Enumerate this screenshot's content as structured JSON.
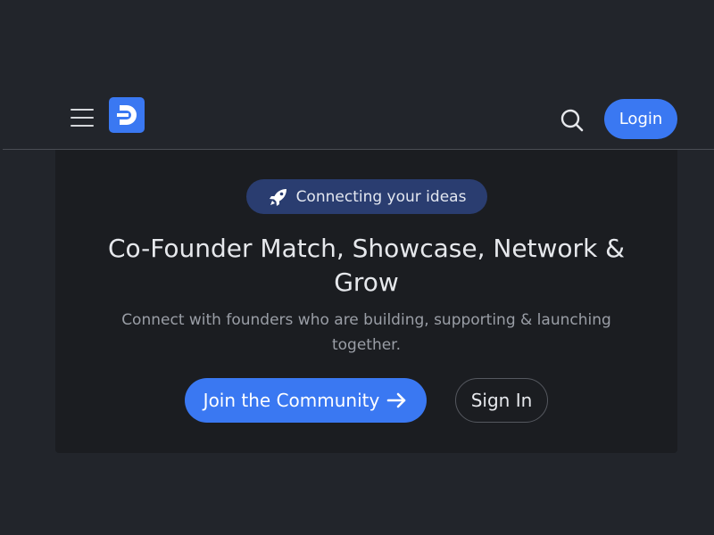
{
  "header": {
    "login_label": "Login",
    "icons": [
      "menu-icon",
      "logo-icon",
      "search-icon"
    ]
  },
  "hero": {
    "badge_text": "Connecting your ideas",
    "badge_icon": "rocket-icon",
    "title": "Co-Founder Match, Showcase, Network & Grow",
    "subtitle": "Connect with founders who are building, supporting & launching together.",
    "join_label": "Join the Community",
    "join_icon": "arrow-right-icon",
    "signin_label": "Sign In"
  },
  "colors": {
    "background": "#22252b",
    "card": "#1b1d21",
    "accent": "#3a78f2",
    "badge": "#2a3d70"
  }
}
